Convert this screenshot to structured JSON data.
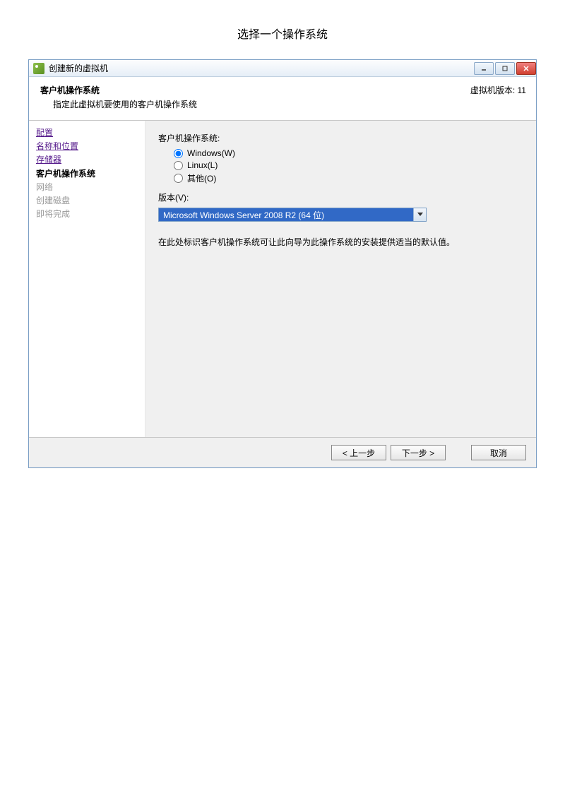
{
  "page": {
    "heading": "选择一个操作系统"
  },
  "titlebar": {
    "title": "创建新的虚拟机"
  },
  "header": {
    "title": "客户机操作系统",
    "subtitle": "指定此虚拟机要使用的客户机操作系统",
    "vmVersion": "虚拟机版本: 11"
  },
  "sidebar": {
    "steps": [
      {
        "label": "配置",
        "state": "link"
      },
      {
        "label": "名称和位置",
        "state": "link"
      },
      {
        "label": "存储器",
        "state": "link"
      },
      {
        "label": "客户机操作系统",
        "state": "current"
      },
      {
        "label": "网络",
        "state": "pending"
      },
      {
        "label": "创建磁盘",
        "state": "pending"
      },
      {
        "label": "即将完成",
        "state": "pending"
      }
    ]
  },
  "content": {
    "osGroupLabel": "客户机操作系统:",
    "radios": {
      "windows": "Windows(W)",
      "linux": "Linux(L)",
      "other": "其他(O)"
    },
    "selectedRadio": "windows",
    "versionLabel": "版本(V):",
    "versionValue": "Microsoft Windows Server 2008 R2 (64 位)",
    "helpText": "在此处标识客户机操作系统可让此向导为此操作系统的安装提供适当的默认值。"
  },
  "footer": {
    "back": "< 上一步",
    "next": "下一步 >",
    "cancel": "取消"
  }
}
